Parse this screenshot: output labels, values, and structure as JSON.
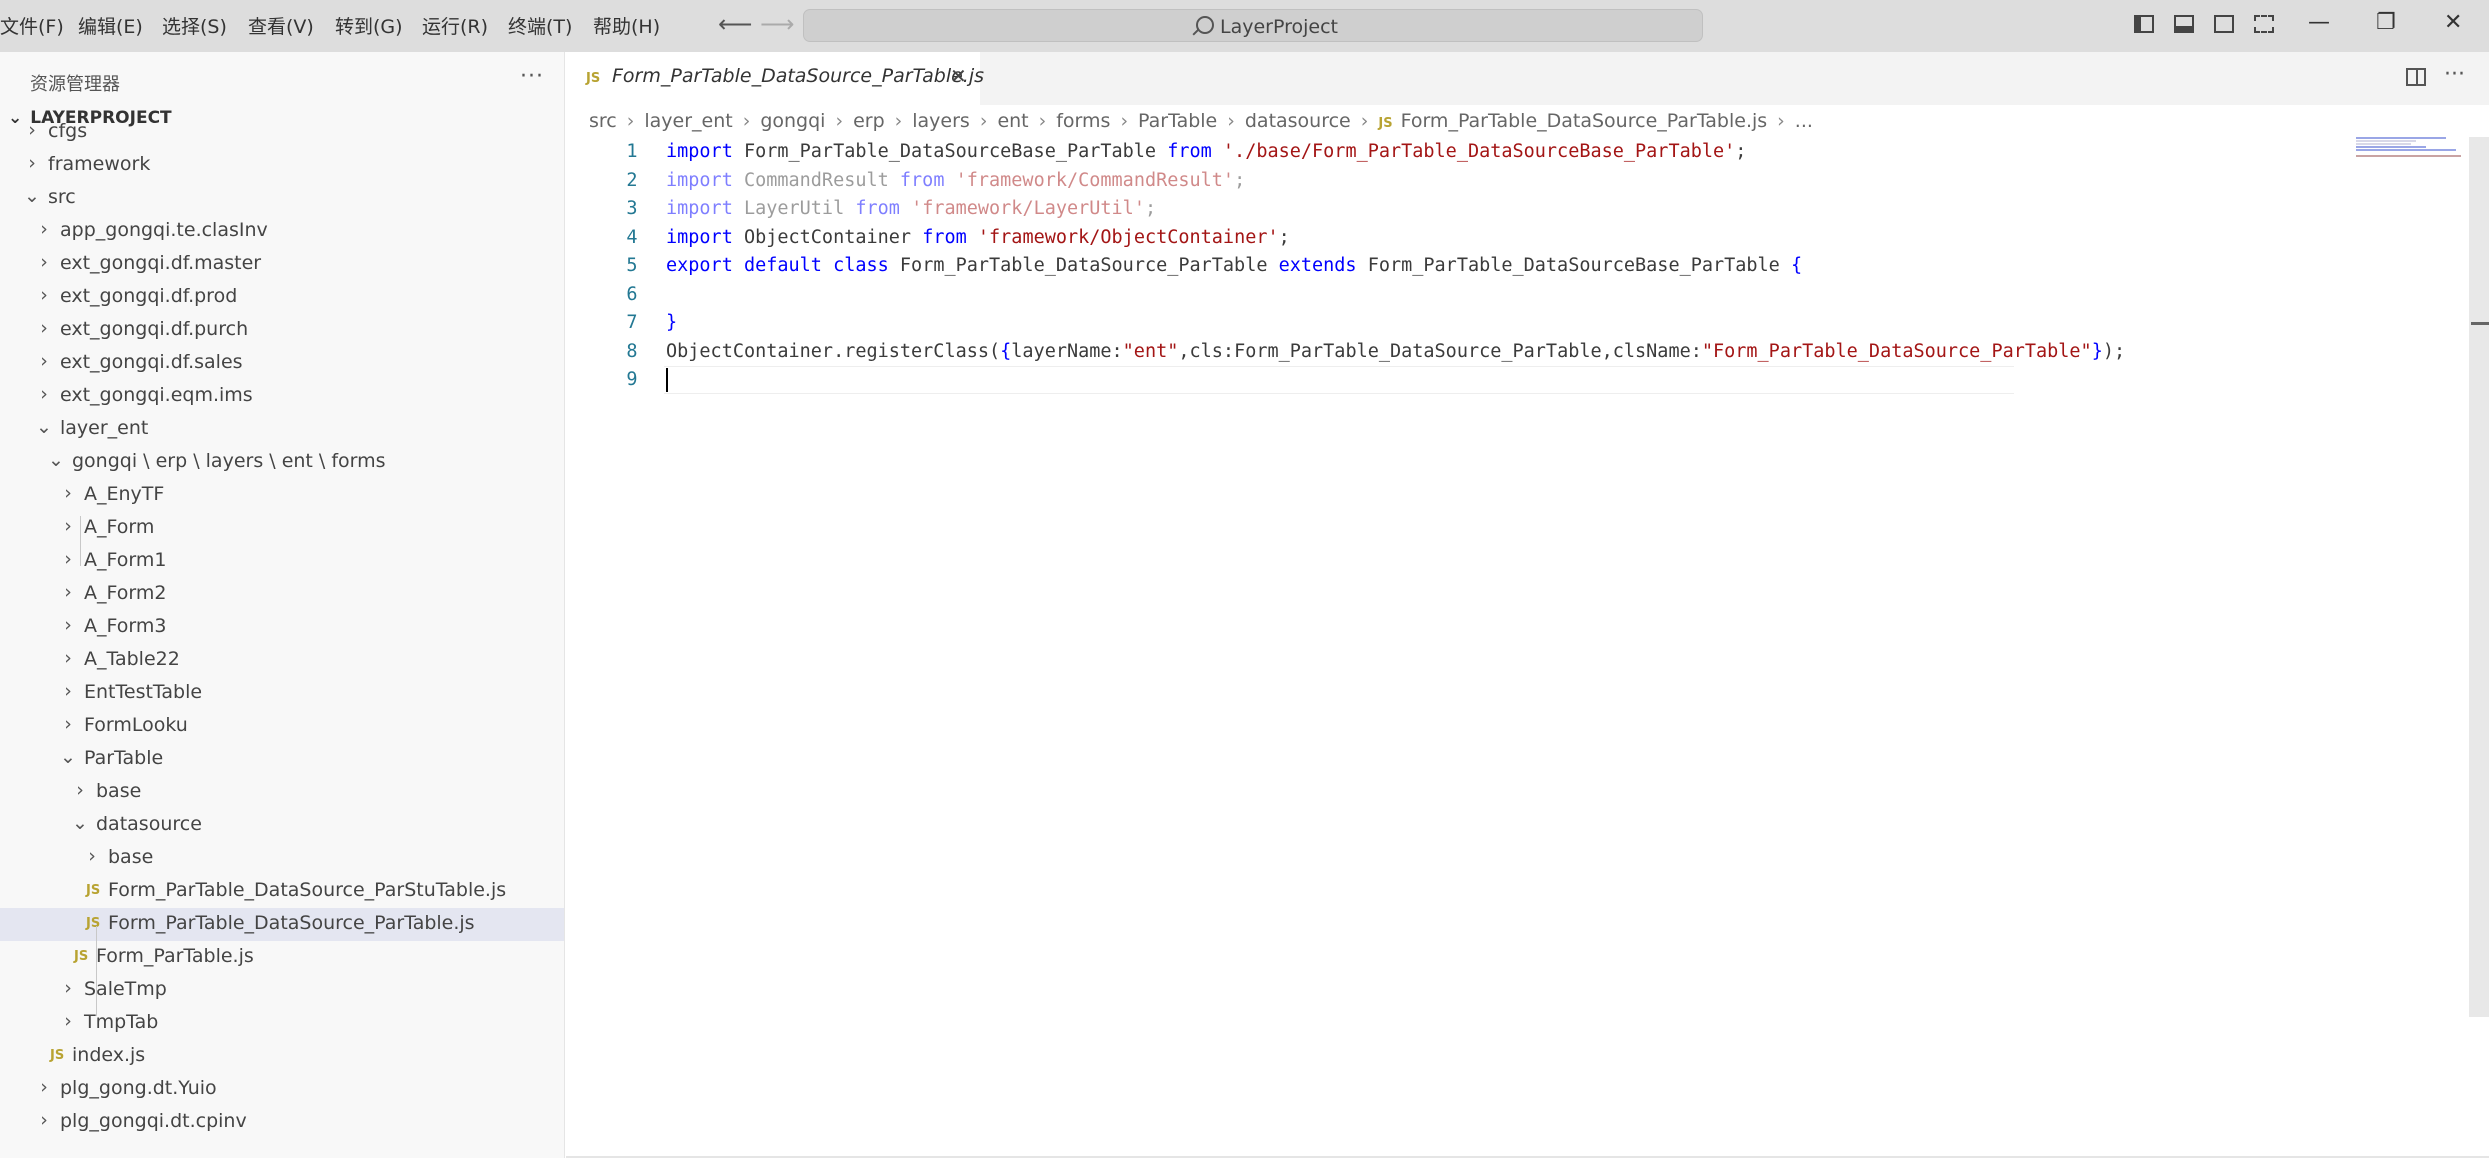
{
  "menu": [
    "文件(F)",
    "编辑(E)",
    "选择(S)",
    "查看(V)",
    "转到(G)",
    "运行(R)",
    "终端(T)",
    "帮助(H)"
  ],
  "search_label": "LayerProject",
  "window_controls": {
    "minimize": "—",
    "maximize": "❐",
    "close": "✕"
  },
  "explorer": {
    "title": "资源管理器",
    "more": "···",
    "project": "LAYERPROJECT",
    "tree": [
      {
        "label": "cfgs",
        "depth": 1,
        "type": "folder",
        "expanded": false
      },
      {
        "label": "framework",
        "depth": 1,
        "type": "folder",
        "expanded": false
      },
      {
        "label": "src",
        "depth": 1,
        "type": "folder",
        "expanded": true
      },
      {
        "label": "app_gongqi.te.clasInv",
        "depth": 2,
        "type": "folder",
        "expanded": false
      },
      {
        "label": "ext_gongqi.df.master",
        "depth": 2,
        "type": "folder",
        "expanded": false
      },
      {
        "label": "ext_gongqi.df.prod",
        "depth": 2,
        "type": "folder",
        "expanded": false
      },
      {
        "label": "ext_gongqi.df.purch",
        "depth": 2,
        "type": "folder",
        "expanded": false
      },
      {
        "label": "ext_gongqi.df.sales",
        "depth": 2,
        "type": "folder",
        "expanded": false
      },
      {
        "label": "ext_gongqi.eqm.ims",
        "depth": 2,
        "type": "folder",
        "expanded": false
      },
      {
        "label": "layer_ent",
        "depth": 2,
        "type": "folder",
        "expanded": true
      },
      {
        "label": "gongqi \\ erp \\ layers \\ ent \\ forms",
        "depth": 3,
        "type": "folder",
        "expanded": true
      },
      {
        "label": "A_EnyTF",
        "depth": 4,
        "type": "folder",
        "expanded": false
      },
      {
        "label": "A_Form",
        "depth": 4,
        "type": "folder",
        "expanded": false
      },
      {
        "label": "A_Form1",
        "depth": 4,
        "type": "folder",
        "expanded": false
      },
      {
        "label": "A_Form2",
        "depth": 4,
        "type": "folder",
        "expanded": false
      },
      {
        "label": "A_Form3",
        "depth": 4,
        "type": "folder",
        "expanded": false
      },
      {
        "label": "A_Table22",
        "depth": 4,
        "type": "folder",
        "expanded": false
      },
      {
        "label": "EntTestTable",
        "depth": 4,
        "type": "folder",
        "expanded": false
      },
      {
        "label": "FormLooku",
        "depth": 4,
        "type": "folder",
        "expanded": false
      },
      {
        "label": "ParTable",
        "depth": 4,
        "type": "folder",
        "expanded": true
      },
      {
        "label": "base",
        "depth": 5,
        "type": "folder",
        "expanded": false
      },
      {
        "label": "datasource",
        "depth": 5,
        "type": "folder",
        "expanded": true
      },
      {
        "label": "base",
        "depth": 6,
        "type": "folder",
        "expanded": false
      },
      {
        "label": "Form_ParTable_DataSource_ParStuTable.js",
        "depth": 6,
        "type": "js"
      },
      {
        "label": "Form_ParTable_DataSource_ParTable.js",
        "depth": 6,
        "type": "js",
        "selected": true
      },
      {
        "label": "Form_ParTable.js",
        "depth": 5,
        "type": "js"
      },
      {
        "label": "SaleTmp",
        "depth": 4,
        "type": "folder",
        "expanded": false
      },
      {
        "label": "TmpTab",
        "depth": 4,
        "type": "folder",
        "expanded": false
      },
      {
        "label": "index.js",
        "depth": 3,
        "type": "js"
      },
      {
        "label": "plg_gong.dt.Yuio",
        "depth": 2,
        "type": "folder",
        "expanded": false
      },
      {
        "label": "plg_gongqi.dt.cpinv",
        "depth": 2,
        "type": "folder",
        "expanded": false
      }
    ]
  },
  "tab": {
    "badge": "JS",
    "name": "Form_ParTable_DataSource_ParTable.js",
    "close": "✕"
  },
  "breadcrumb": [
    "src",
    "layer_ent",
    "gongqi",
    "erp",
    "layers",
    "ent",
    "forms",
    "ParTable",
    "datasource",
    "Form_ParTable_DataSource_ParTable.js",
    "..."
  ],
  "code": [
    [
      [
        "kw",
        "import"
      ],
      [
        "",
        " Form_ParTable_DataSourceBase_ParTable "
      ],
      [
        "kw",
        "from"
      ],
      [
        "",
        " "
      ],
      [
        "str",
        "'./base/Form_ParTable_DataSourceBase_ParTable'"
      ],
      [
        "",
        ";"
      ]
    ],
    [
      [
        "kw dim",
        "import"
      ],
      [
        "dim",
        " CommandResult "
      ],
      [
        "kw dim",
        "from"
      ],
      [
        "dim",
        " "
      ],
      [
        "str dim",
        "'framework/CommandResult'"
      ],
      [
        "dim",
        ";"
      ]
    ],
    [
      [
        "kw dim",
        "import"
      ],
      [
        "dim",
        " LayerUtil "
      ],
      [
        "kw dim",
        "from"
      ],
      [
        "dim",
        " "
      ],
      [
        "str dim",
        "'framework/LayerUtil'"
      ],
      [
        "dim",
        ";"
      ]
    ],
    [
      [
        "kw",
        "import"
      ],
      [
        "",
        " ObjectContainer "
      ],
      [
        "kw",
        "from"
      ],
      [
        "",
        " "
      ],
      [
        "str",
        "'framework/ObjectContainer'"
      ],
      [
        "",
        ";"
      ]
    ],
    [
      [
        "kw",
        "export"
      ],
      [
        "",
        " "
      ],
      [
        "kw",
        "default"
      ],
      [
        "",
        " "
      ],
      [
        "kw",
        "class"
      ],
      [
        "",
        " Form_ParTable_DataSource_ParTable "
      ],
      [
        "kw",
        "extends"
      ],
      [
        "",
        " Form_ParTable_DataSourceBase_ParTable "
      ],
      [
        "kw",
        "{"
      ]
    ],
    [],
    [
      [
        "kw",
        "}"
      ]
    ],
    [
      [
        "",
        "ObjectContainer.registerClass("
      ],
      [
        "kw",
        "{"
      ],
      [
        "",
        "layerName:"
      ],
      [
        "str",
        "\"ent\""
      ],
      [
        "",
        ",cls:Form_ParTable_DataSource_ParTable,clsName:"
      ],
      [
        "str",
        "\"Form_ParTable_DataSource_ParTable\""
      ],
      [
        "kw",
        "}"
      ],
      [
        "",
        ");"
      ]
    ],
    []
  ],
  "colors": {
    "keyword": "#0000ff",
    "string": "#a31515",
    "line_number": "#237893",
    "selection": "#e4e6f1",
    "js_badge": "#b8a332"
  },
  "icons": [
    "search-icon",
    "arrow-left-icon",
    "arrow-right-icon",
    "chevron-right-icon",
    "chevron-down-icon",
    "js-file-icon",
    "split-editor-icon",
    "more-icon",
    "close-icon"
  ]
}
